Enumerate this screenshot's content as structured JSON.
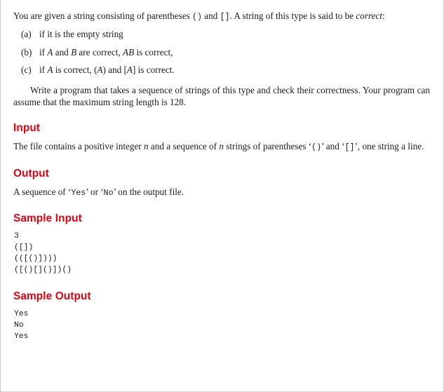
{
  "theme": {
    "heading_color": "#e8000d",
    "text_color": "#1a1a26",
    "page_background": "#ffffff",
    "border_color": "#c9c9c9"
  },
  "intro": {
    "part1": "You are given a string consisting of parentheses ",
    "code_paren": "()",
    "part2": " and ",
    "code_bracket": "[]",
    "part3": ". A string of this type is said to be ",
    "emphasis": "correct",
    "part4": ":"
  },
  "conditions": [
    {
      "label": "(a)",
      "segments": [
        {
          "type": "text",
          "value": "if it is the empty string"
        }
      ]
    },
    {
      "label": "(b)",
      "segments": [
        {
          "type": "text",
          "value": "if "
        },
        {
          "type": "math",
          "value": "A"
        },
        {
          "type": "text",
          "value": " and "
        },
        {
          "type": "math",
          "value": "B"
        },
        {
          "type": "text",
          "value": " are correct, "
        },
        {
          "type": "math",
          "value": "AB"
        },
        {
          "type": "text",
          "value": " is correct,"
        }
      ]
    },
    {
      "label": "(c)",
      "segments": [
        {
          "type": "text",
          "value": "if "
        },
        {
          "type": "math",
          "value": "A"
        },
        {
          "type": "text",
          "value": " is correct, ("
        },
        {
          "type": "math",
          "value": "A"
        },
        {
          "type": "text",
          "value": ") and ["
        },
        {
          "type": "math",
          "value": "A"
        },
        {
          "type": "text",
          "value": "] is correct."
        }
      ]
    }
  ],
  "task_paragraph": "Write a program that takes a sequence of strings of this type and check their correctness. Your program can assume that the maximum string length is 128.",
  "sections": {
    "input": {
      "heading": "Input",
      "part1": "The file contains a positive integer ",
      "var1": "n",
      "part2": " and a sequence of ",
      "var2": "n",
      "part3": " strings of parentheses ‘",
      "code1": "()",
      "part4": "’ and ‘",
      "code2": "[]",
      "part5": "’, one string a line."
    },
    "output": {
      "heading": "Output",
      "part1": "A sequence of ‘",
      "code1": "Yes",
      "part2": "’ or ‘",
      "code2": "No",
      "part3": "’ on the output file."
    },
    "sample_input": {
      "heading": "Sample Input",
      "lines": [
        "3",
        "([])",
        "(([()])))",
        "([()[]()])()"
      ]
    },
    "sample_output": {
      "heading": "Sample Output",
      "lines": [
        "Yes",
        "No",
        "Yes"
      ]
    }
  }
}
